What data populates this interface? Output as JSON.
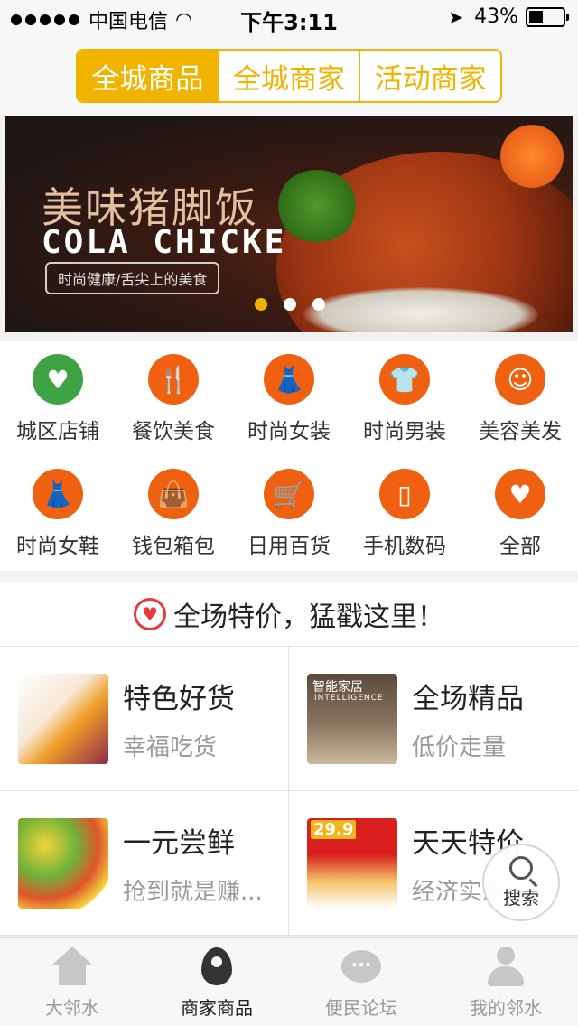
{
  "status_bar": {
    "carrier": "中国电信",
    "time": "下午3:11",
    "battery": "43%",
    "battery_level": 0.43
  },
  "header": {
    "tabs": [
      {
        "label": "全城商品",
        "active": true
      },
      {
        "label": "全城商家",
        "active": false
      },
      {
        "label": "活动商家",
        "active": false
      }
    ]
  },
  "banner": {
    "title_cn": "美味猪脚饭",
    "title_en": "COLA CHICKE",
    "tagline": "时尚健康/舌尖上的美食",
    "page_count": 3,
    "active_page": 1
  },
  "categories": [
    {
      "label": "城区店铺",
      "icon": "heart-hands-icon"
    },
    {
      "label": "餐饮美食",
      "icon": "fork-knife-icon"
    },
    {
      "label": "时尚女装",
      "icon": "dress-icon"
    },
    {
      "label": "时尚男装",
      "icon": "tshirt-icon"
    },
    {
      "label": "美容美发",
      "icon": "face-profile-icon"
    },
    {
      "label": "时尚女鞋",
      "icon": "dress-icon"
    },
    {
      "label": "钱包箱包",
      "icon": "handbag-icon"
    },
    {
      "label": "日用百货",
      "icon": "cart-icon"
    },
    {
      "label": "手机数码",
      "icon": "phone-icon"
    },
    {
      "label": "全部",
      "icon": "heart-hands-icon"
    }
  ],
  "promo": {
    "title": "全场特价，猛戳这里！"
  },
  "cards": [
    {
      "title": "特色好货",
      "subtitle": "幸福吃货"
    },
    {
      "title": "全场精品",
      "subtitle": "低价走量",
      "thumb_text": "智能家居",
      "thumb_text2": "INTELLIGENCE"
    },
    {
      "title": "一元尝鲜",
      "subtitle": "抢到就是赚..."
    },
    {
      "title": "天天特价",
      "subtitle": "经济实惠",
      "thumb_price": "29.9"
    }
  ],
  "search_fab": {
    "label": "搜索"
  },
  "tabbar": [
    {
      "label": "大邻水",
      "active": false
    },
    {
      "label": "商家商品",
      "active": true
    },
    {
      "label": "便民论坛",
      "active": false
    },
    {
      "label": "我的邻水",
      "active": false
    }
  ],
  "colors": {
    "accent": "#f0b400",
    "icon_orange": "#f06011",
    "icon_green": "#3fa343",
    "heart_red": "#e83a3a"
  }
}
